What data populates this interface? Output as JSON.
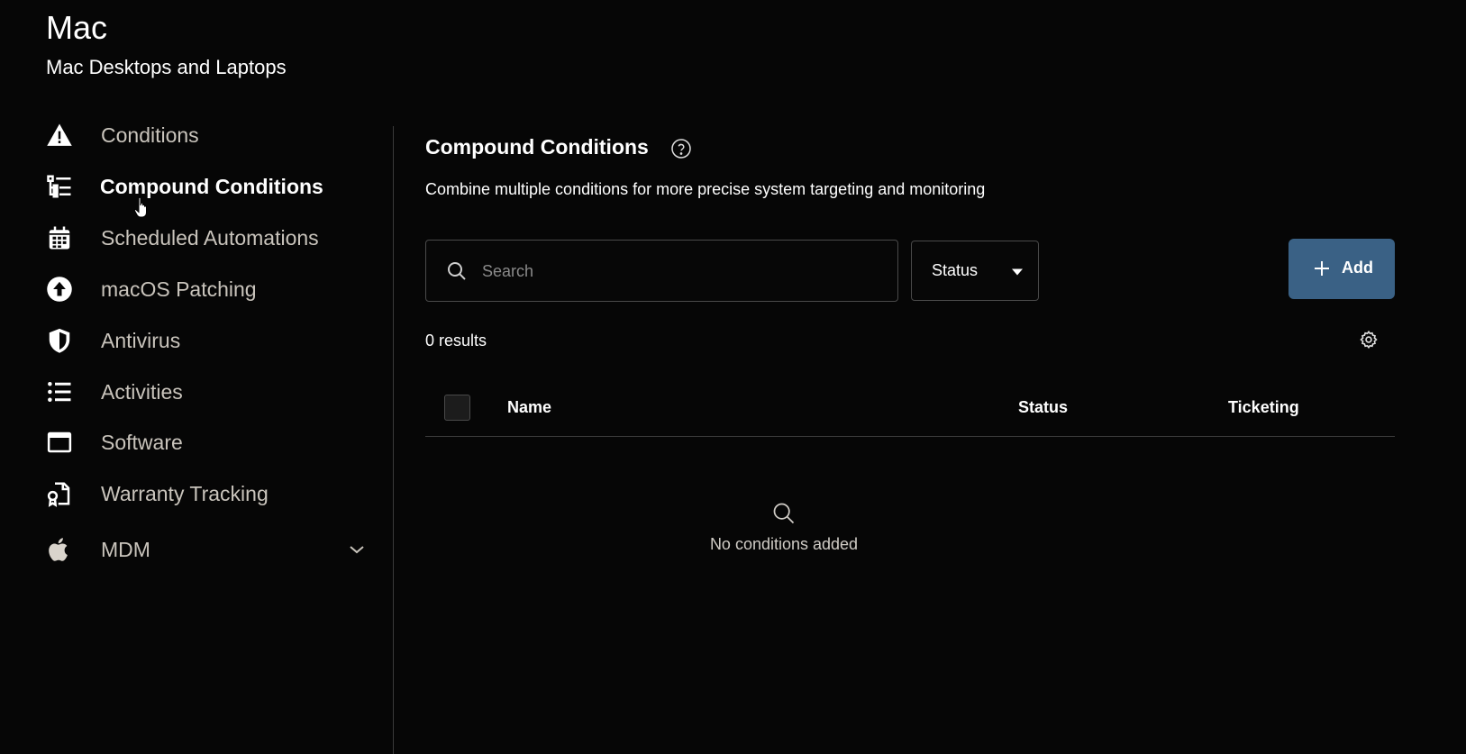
{
  "header": {
    "title": "Mac",
    "subtitle": "Mac Desktops and Laptops"
  },
  "sidebar": {
    "items": [
      {
        "label": "Conditions",
        "icon": "warning-icon",
        "active": false
      },
      {
        "label": "Compound Conditions",
        "icon": "compound-list-icon",
        "active": true
      },
      {
        "label": "Scheduled Automations",
        "icon": "calendar-icon",
        "active": false
      },
      {
        "label": "macOS Patching",
        "icon": "upload-circle-icon",
        "active": false
      },
      {
        "label": "Antivirus",
        "icon": "shield-icon",
        "active": false
      },
      {
        "label": "Activities",
        "icon": "list-icon",
        "active": false
      },
      {
        "label": "Software",
        "icon": "window-icon",
        "active": false
      },
      {
        "label": "Warranty Tracking",
        "icon": "warranty-document-icon",
        "active": false
      },
      {
        "label": "MDM",
        "icon": "apple-icon",
        "active": false,
        "expandable": true
      }
    ]
  },
  "main": {
    "title": "Compound Conditions",
    "description": "Combine multiple conditions for more precise system targeting and monitoring",
    "search": {
      "placeholder": "Search",
      "value": ""
    },
    "status_filter": {
      "label": "Status"
    },
    "add_button": {
      "label": "Add"
    },
    "results_count": "0 results",
    "table": {
      "columns": [
        "Name",
        "Status",
        "Ticketing"
      ],
      "rows": []
    },
    "empty_state": {
      "text": "No conditions added"
    }
  },
  "colors": {
    "background": "#060606",
    "accent": "#3a6185",
    "nav_text": "#c9c4bc",
    "divider": "#3a3a3a"
  }
}
